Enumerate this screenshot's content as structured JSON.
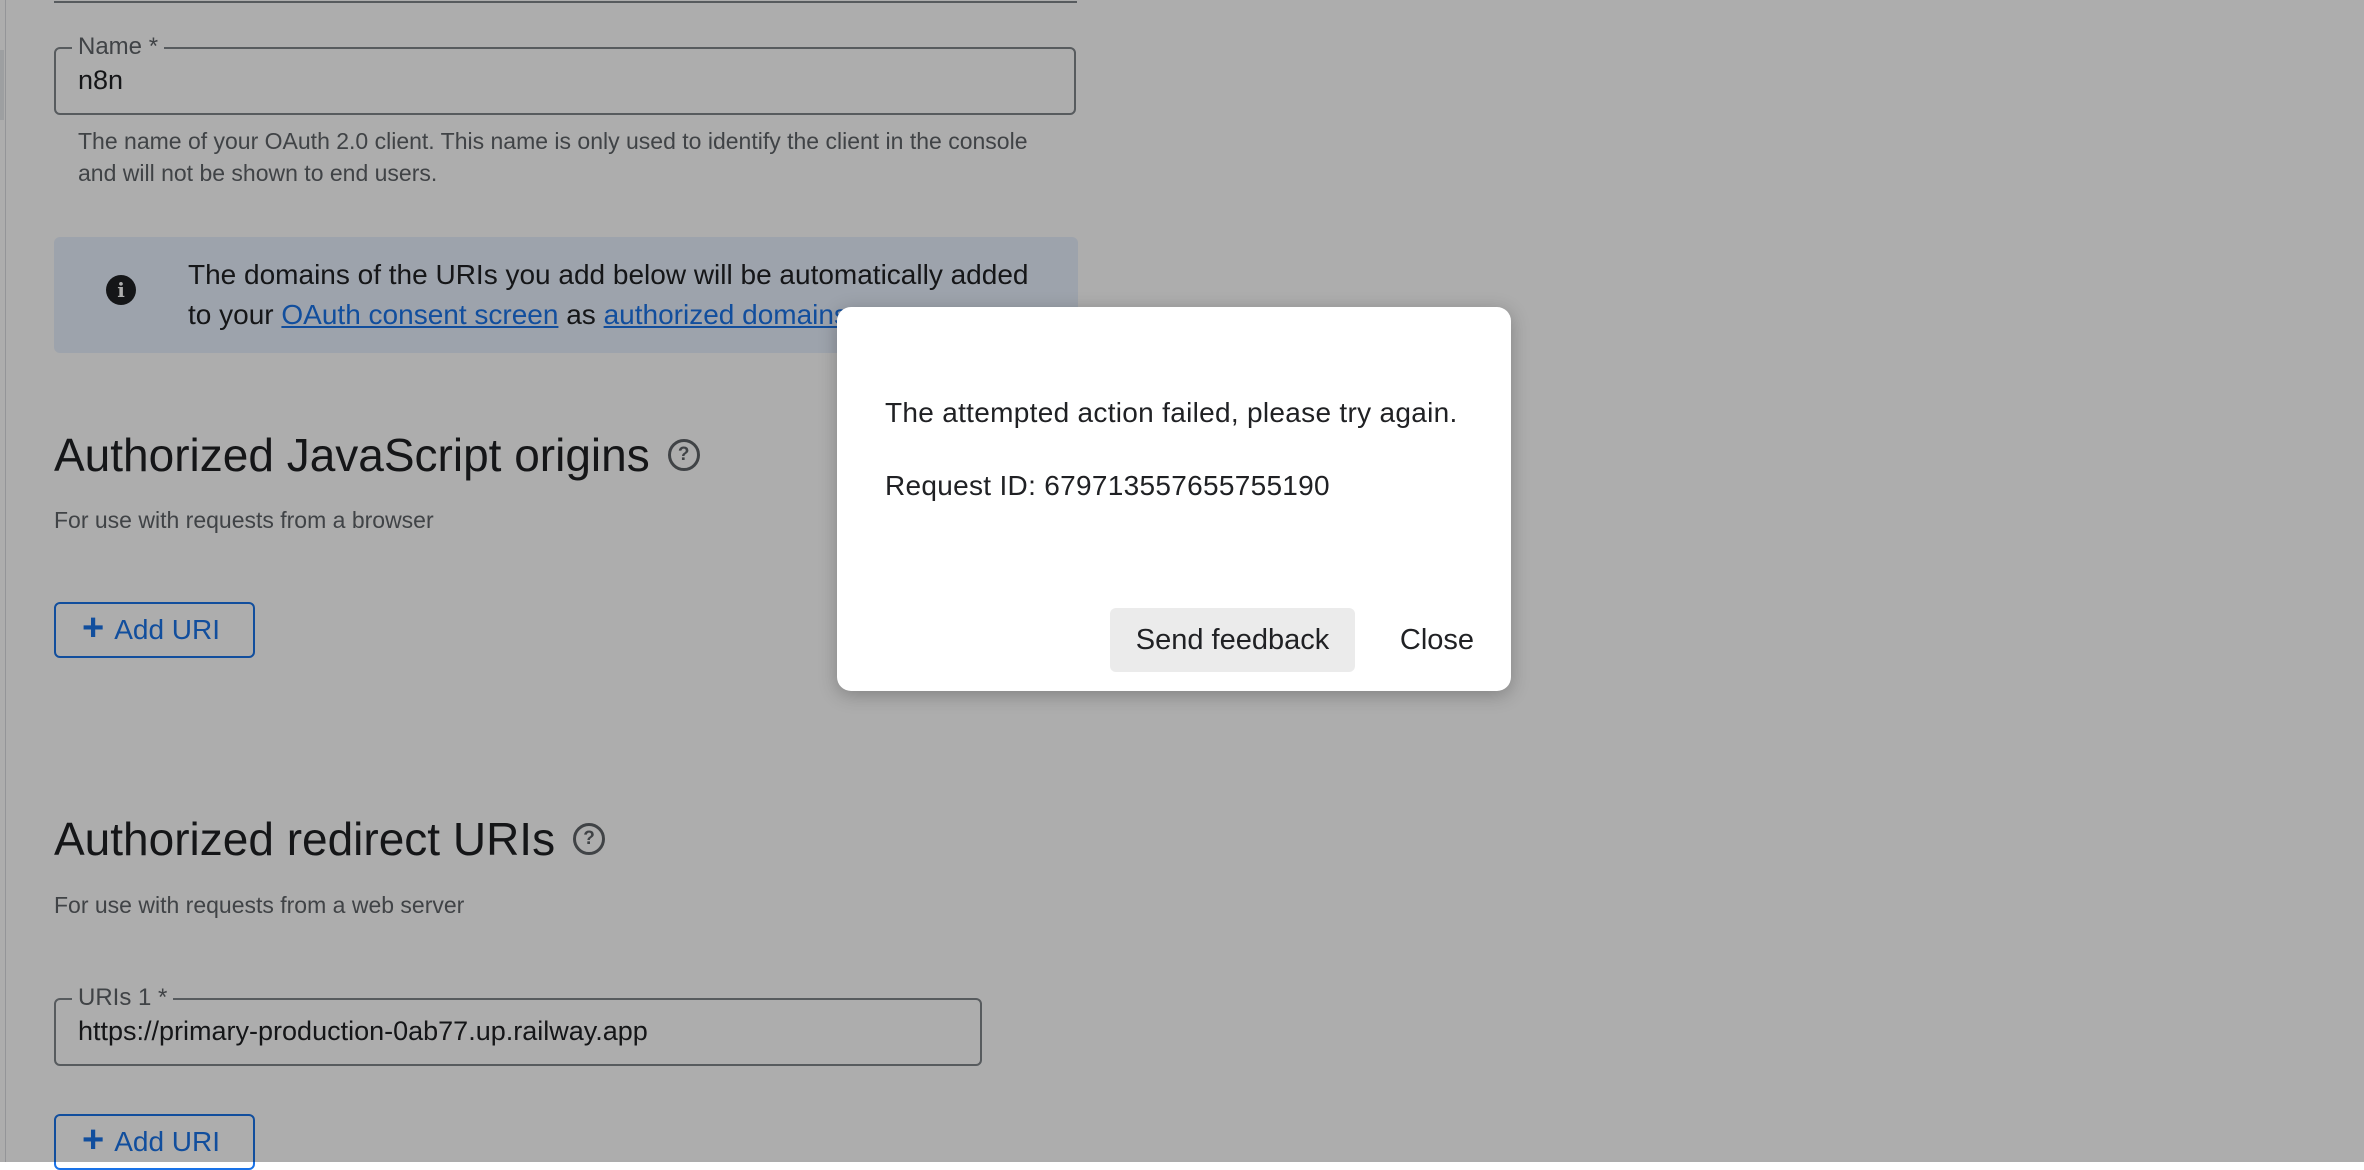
{
  "form": {
    "name_field": {
      "label": "Name *",
      "value": "n8n"
    },
    "name_helper": "The name of your OAuth 2.0 client. This name is only used to identify the client in the console and will not be shown to end users.",
    "banner": {
      "text_before": "The domains of the URIs you add below will be automatically added to your ",
      "link_consent": "OAuth consent screen",
      "text_middle": " as ",
      "link_domains": "authorized domains"
    },
    "js_origins": {
      "title": "Authorized JavaScript origins",
      "description": "For use with requests from a browser",
      "add_button": "Add URI"
    },
    "redirect_uris": {
      "title": "Authorized redirect URIs",
      "description": "For use with requests from a web server",
      "uri_field": {
        "label": "URIs 1 *",
        "value": "https://primary-production-0ab77.up.railway.app"
      },
      "add_button": "Add URI"
    }
  },
  "dialog": {
    "message": "The attempted action failed, please try again.",
    "request_id": "Request ID: 679713557655755190",
    "send_feedback": "Send feedback",
    "close": "Close"
  },
  "icons": {
    "info": "info-icon",
    "help": "help-circle-icon",
    "add": "plus-icon"
  },
  "colors": {
    "link": "#1a73e8",
    "banner_bg": "#e8f0fe",
    "scrim": "rgba(0,0,0,0.32)"
  }
}
